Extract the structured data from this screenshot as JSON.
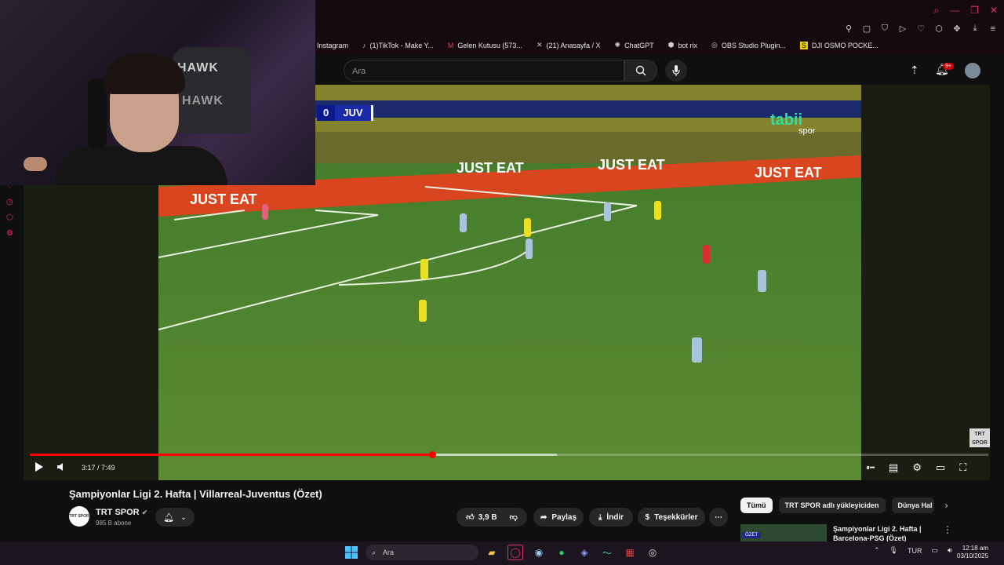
{
  "bookmarks": [
    {
      "label": "Instagram"
    },
    {
      "label": "(1)TikTok - Make Y..."
    },
    {
      "label": "Gelen Kutusu (573..."
    },
    {
      "label": "(21) Anasayfa / X"
    },
    {
      "label": "ChatGPT"
    },
    {
      "label": "bot rix"
    },
    {
      "label": "OBS Studio Plugin..."
    },
    {
      "label": "DJI OSMO POCKE..."
    }
  ],
  "webcam": {
    "chair_logo": "HAWK",
    "chair_logo_2": "HAWK"
  },
  "search": {
    "placeholder": "Ara"
  },
  "masthead": {
    "notification_count": "9+"
  },
  "video": {
    "score": "0",
    "team": "JUV",
    "channel_watermark": "tabii",
    "channel_watermark_sub": "spor",
    "corner_logo": "TRT SPOR",
    "board_text": "JUST EAT",
    "current_time": "3:17",
    "duration": "7:49",
    "time_display": "3:17 / 7:49",
    "progress_fraction": 0.4205,
    "buffered_fraction": 0.55
  },
  "details": {
    "title": "Şampiyonlar Ligi 2. Hafta | Villarreal-Juventus (Özet)",
    "channel_name": "TRT SPOR",
    "channel_avatar": "TRT SPOR",
    "subscribers": "985 B abone",
    "likes": "3,9 B",
    "share_label": "Paylaş",
    "download_label": "İndir",
    "thanks_label": "Teşekkürler"
  },
  "chips": [
    "Tümü",
    "TRT SPOR adlı yükleyiciden",
    "Dünya Hal"
  ],
  "recommendation": {
    "title": "Şampiyonlar Ligi 2. Hafta | Barcelona-PSG (Özet)",
    "tag": "ÖZET"
  },
  "taskbar": {
    "search_label": "Ara",
    "language": "TUR",
    "time": "12:18 am",
    "date": "03/10/2025"
  },
  "sidebar_bottom": {
    "gx": "GX"
  },
  "colors": {
    "accent": "#e0336b",
    "progress": "#ff0000",
    "pitch": "#4e7a2e"
  }
}
